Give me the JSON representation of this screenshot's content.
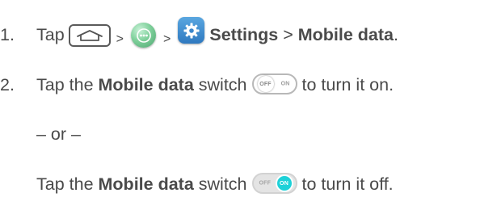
{
  "step1": {
    "number": "1.",
    "tap": "Tap",
    "sep1": ">",
    "sep2": ">",
    "settings_label": "Settings",
    "sep3": ">",
    "mobile_data_label": "Mobile data",
    "end": "."
  },
  "step2": {
    "number": "2.",
    "tap": "Tap the",
    "mobile_data_label": "Mobile data",
    "switch_word": "switch",
    "tail": "to turn it on."
  },
  "or_text": "– or –",
  "alt": {
    "tap": "Tap the",
    "mobile_data_label": "Mobile data",
    "switch_word": "switch",
    "tail": "to turn it off."
  },
  "toggle_labels": {
    "off": "OFF",
    "on": "ON"
  },
  "icons": {
    "home": "home-key-icon",
    "apps": "apps-icon",
    "settings": "settings-gear-icon",
    "switch_off": "toggle-off-icon",
    "switch_on": "toggle-on-icon"
  },
  "colors": {
    "text": "#4a4a4a",
    "apps_green": "#7fd09b",
    "settings_blue": "#2f79c0",
    "toggle_on": "#1ed1d8"
  }
}
